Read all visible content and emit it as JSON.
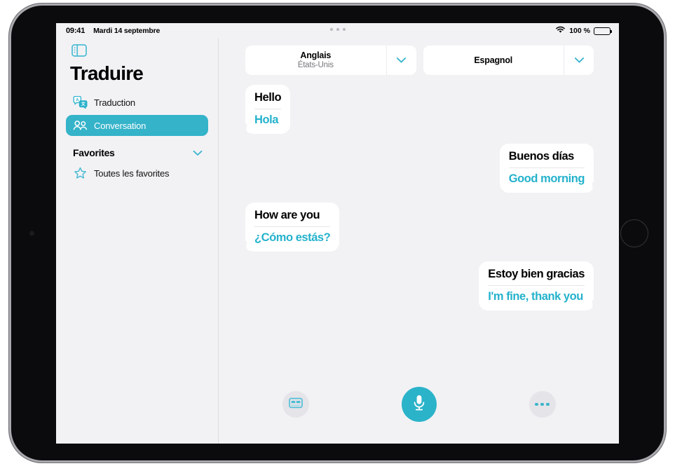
{
  "status_bar": {
    "time": "09:41",
    "date": "Mardi 14 septembre",
    "battery_percent": "100 %",
    "wifi_icon": "wifi-icon",
    "battery_icon": "battery-icon"
  },
  "sidebar": {
    "toggle_icon": "sidebar-toggle-icon",
    "title": "Traduire",
    "items": [
      {
        "label": "Traduction",
        "icon": "translate-bubbles-icon",
        "active": false
      },
      {
        "label": "Conversation",
        "icon": "two-people-icon",
        "active": true
      }
    ],
    "section": {
      "title": "Favorites",
      "chevron_icon": "chevron-down-icon",
      "items": [
        {
          "label": "Toutes les favorites",
          "icon": "star-icon"
        }
      ]
    }
  },
  "languages": {
    "source": {
      "name": "Anglais",
      "region": "États-Unis",
      "chevron_icon": "chevron-down-icon"
    },
    "target": {
      "name": "Espagnol",
      "region": "",
      "chevron_icon": "chevron-down-icon"
    }
  },
  "conversation": {
    "messages": [
      {
        "side": "left",
        "source": "Hello",
        "translation": "Hola"
      },
      {
        "side": "right",
        "source": "Buenos días",
        "translation": "Good morning"
      },
      {
        "side": "left",
        "source": "How are you",
        "translation": "¿Cómo estás?"
      },
      {
        "side": "right",
        "source": "Estoy bien gracias",
        "translation": "I'm fine, thank you"
      }
    ]
  },
  "toolbar": {
    "subtitles_icon": "subtitles-card-icon",
    "mic_icon": "microphone-icon",
    "more_icon": "ellipsis-icon"
  },
  "colors": {
    "accent": "#2bb3c9",
    "translation_text": "#24b2cc",
    "background": "#f2f2f5",
    "bubble": "#ffffff"
  },
  "multitask_handle": "multitask-handle"
}
